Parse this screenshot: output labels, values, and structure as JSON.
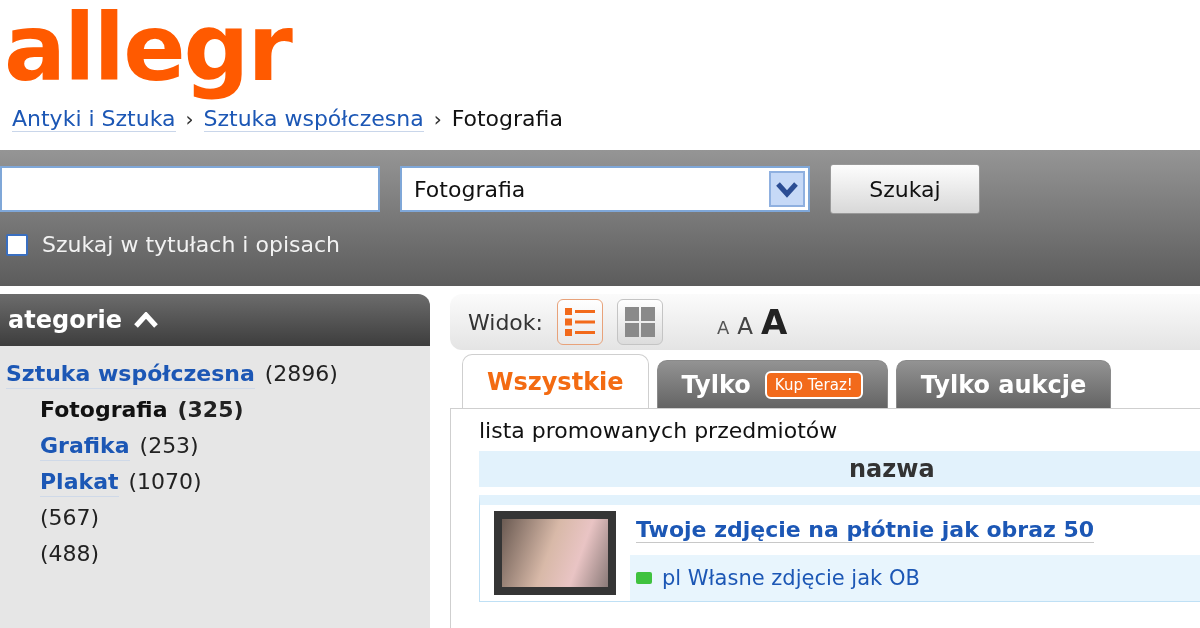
{
  "header": {
    "logo": "allegr"
  },
  "breadcrumb": {
    "separator": "›",
    "items": [
      {
        "label": "Antyki i Sztuka",
        "current": false
      },
      {
        "label": "Sztuka współczesna",
        "current": false
      },
      {
        "label": "Fotografia",
        "current": true
      }
    ]
  },
  "search": {
    "category": "Fotografia",
    "button": "Szukaj",
    "in_descriptions": {
      "label": "Szukaj w tytułach i opisach",
      "checked": false
    }
  },
  "sidebar": {
    "title": "ategorie",
    "expanded": true,
    "categories": [
      {
        "name": "Sztuka współczesna",
        "count": "(2896)",
        "selected": false,
        "children": [
          {
            "name": "Fotografia",
            "count": "(325)",
            "selected": true
          },
          {
            "name": "Grafika",
            "count": "(253)",
            "selected": false
          },
          {
            "name": "Plakat",
            "count": "(1070)",
            "selected": false
          },
          {
            "count": "(567)",
            "selected": false
          },
          {
            "count": "(488)",
            "selected": false
          }
        ]
      }
    ]
  },
  "view": {
    "label": "Widok:",
    "modes": [
      {
        "kind": "list",
        "selected": true
      },
      {
        "kind": "grid",
        "selected": false
      }
    ],
    "font_sizes": [
      {
        "label": "A",
        "kind": "small"
      },
      {
        "label": "A",
        "kind": "medium"
      },
      {
        "label": "A",
        "kind": "large"
      }
    ]
  },
  "tabs": [
    {
      "label": "Wszystkie",
      "selected": true
    },
    {
      "label": "Tylko",
      "badge": "Kup Teraz!",
      "selected": false
    },
    {
      "label": "Tylko aukcje",
      "selected": false
    }
  ],
  "listing": {
    "caption": "lista promowanych przedmiotów",
    "columns": [
      "nazwa"
    ],
    "items": [
      {
        "title": "Twoje zdjęcie na płótnie jak obraz 50",
        "description": "pl Własne zdjęcie jak OB"
      }
    ]
  }
}
